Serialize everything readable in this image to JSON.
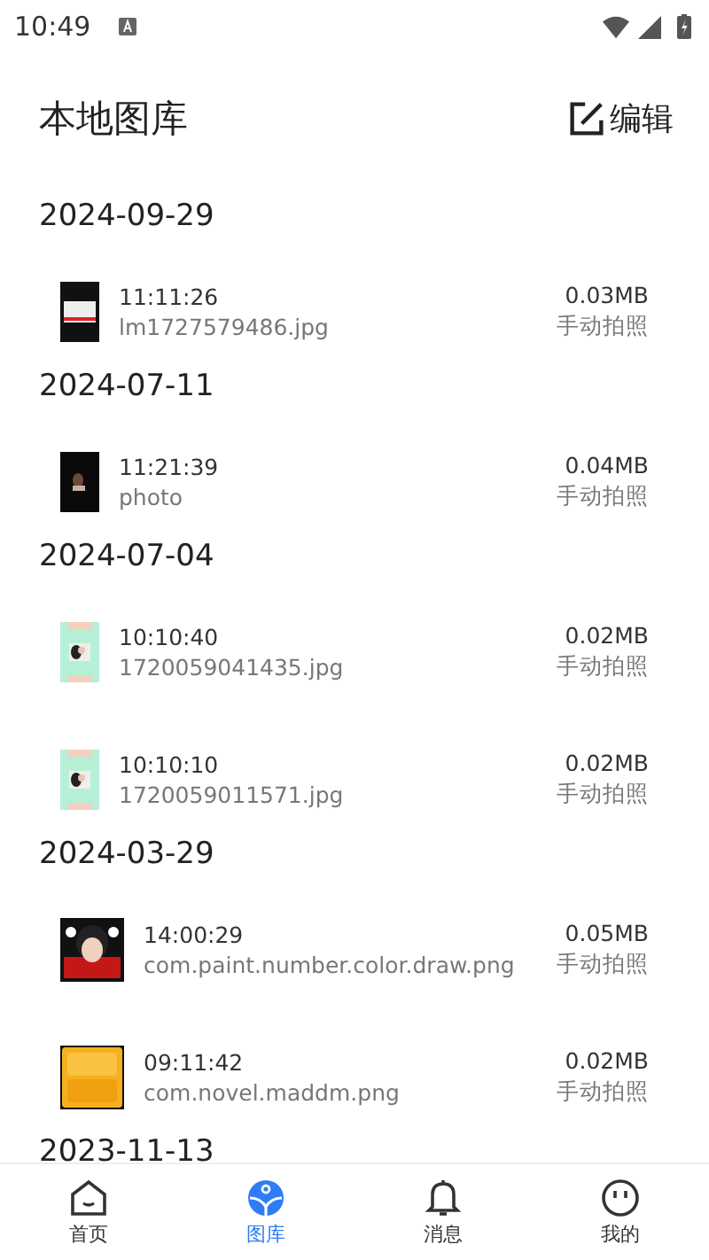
{
  "status_bar": {
    "time": "10:49"
  },
  "header": {
    "title": "本地图库",
    "edit_label": "编辑"
  },
  "groups": [
    {
      "date": "2024-09-29",
      "items": [
        {
          "time": "11:11:26",
          "name": "lm1727579486.jpg",
          "size": "0.03MB",
          "source": "手动拍照"
        }
      ]
    },
    {
      "date": "2024-07-11",
      "items": [
        {
          "time": "11:21:39",
          "name": "photo",
          "size": "0.04MB",
          "source": "手动拍照"
        }
      ]
    },
    {
      "date": "2024-07-04",
      "items": [
        {
          "time": "10:10:40",
          "name": "1720059041435.jpg",
          "size": "0.02MB",
          "source": "手动拍照"
        },
        {
          "time": "10:10:10",
          "name": "1720059011571.jpg",
          "size": "0.02MB",
          "source": "手动拍照"
        }
      ]
    },
    {
      "date": "2024-03-29",
      "items": [
        {
          "time": "14:00:29",
          "name": "com.paint.number.color.draw.png",
          "size": "0.05MB",
          "source": "手动拍照"
        },
        {
          "time": "09:11:42",
          "name": "com.novel.maddm.png",
          "size": "0.02MB",
          "source": "手动拍照"
        }
      ]
    },
    {
      "date": "2023-11-13"
    }
  ],
  "nav": [
    {
      "label": "首页",
      "kind": "home",
      "selected": false
    },
    {
      "label": "图库",
      "kind": "gallery",
      "selected": true
    },
    {
      "label": "消息",
      "kind": "bell",
      "selected": false
    },
    {
      "label": "我的",
      "kind": "face",
      "selected": false
    }
  ]
}
